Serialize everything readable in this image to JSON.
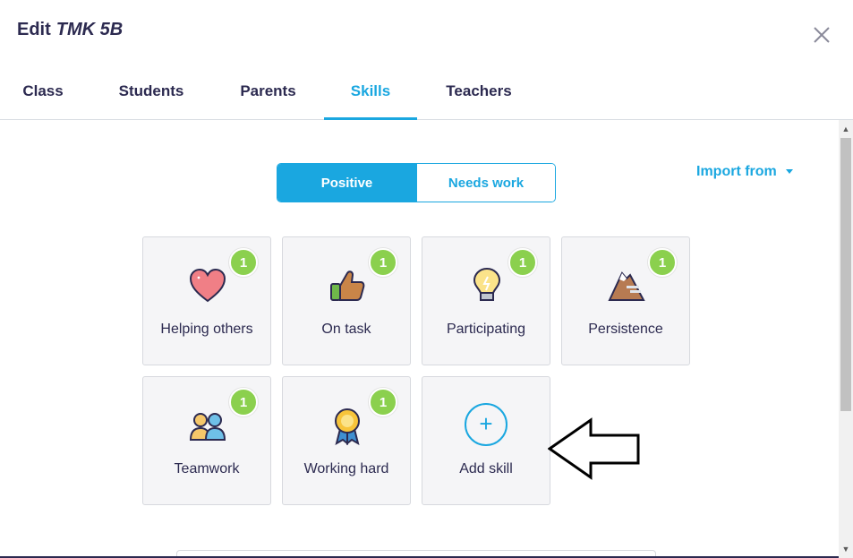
{
  "modal": {
    "title_prefix": "Edit",
    "class_name": "TMK 5B"
  },
  "tabs": [
    {
      "label": "Class",
      "active": false
    },
    {
      "label": "Students",
      "active": false
    },
    {
      "label": "Parents",
      "active": false
    },
    {
      "label": "Skills",
      "active": true
    },
    {
      "label": "Teachers",
      "active": false
    }
  ],
  "toggle": {
    "positive_label": "Positive",
    "needs_work_label": "Needs work",
    "selected": "Positive"
  },
  "import": {
    "label": "Import from"
  },
  "skills": [
    {
      "name": "Helping others",
      "points": "1",
      "icon": "heart-icon"
    },
    {
      "name": "On task",
      "points": "1",
      "icon": "thumbs-up-icon"
    },
    {
      "name": "Participating",
      "points": "1",
      "icon": "lightbulb-icon"
    },
    {
      "name": "Persistence",
      "points": "1",
      "icon": "mountain-icon"
    },
    {
      "name": "Teamwork",
      "points": "1",
      "icon": "people-icon"
    },
    {
      "name": "Working hard",
      "points": "1",
      "icon": "medal-icon"
    }
  ],
  "add_skill": {
    "label": "Add skill",
    "symbol": "+"
  },
  "colors": {
    "accent": "#1aa7e0",
    "badge": "#8bd04e",
    "text": "#2c2a50"
  }
}
